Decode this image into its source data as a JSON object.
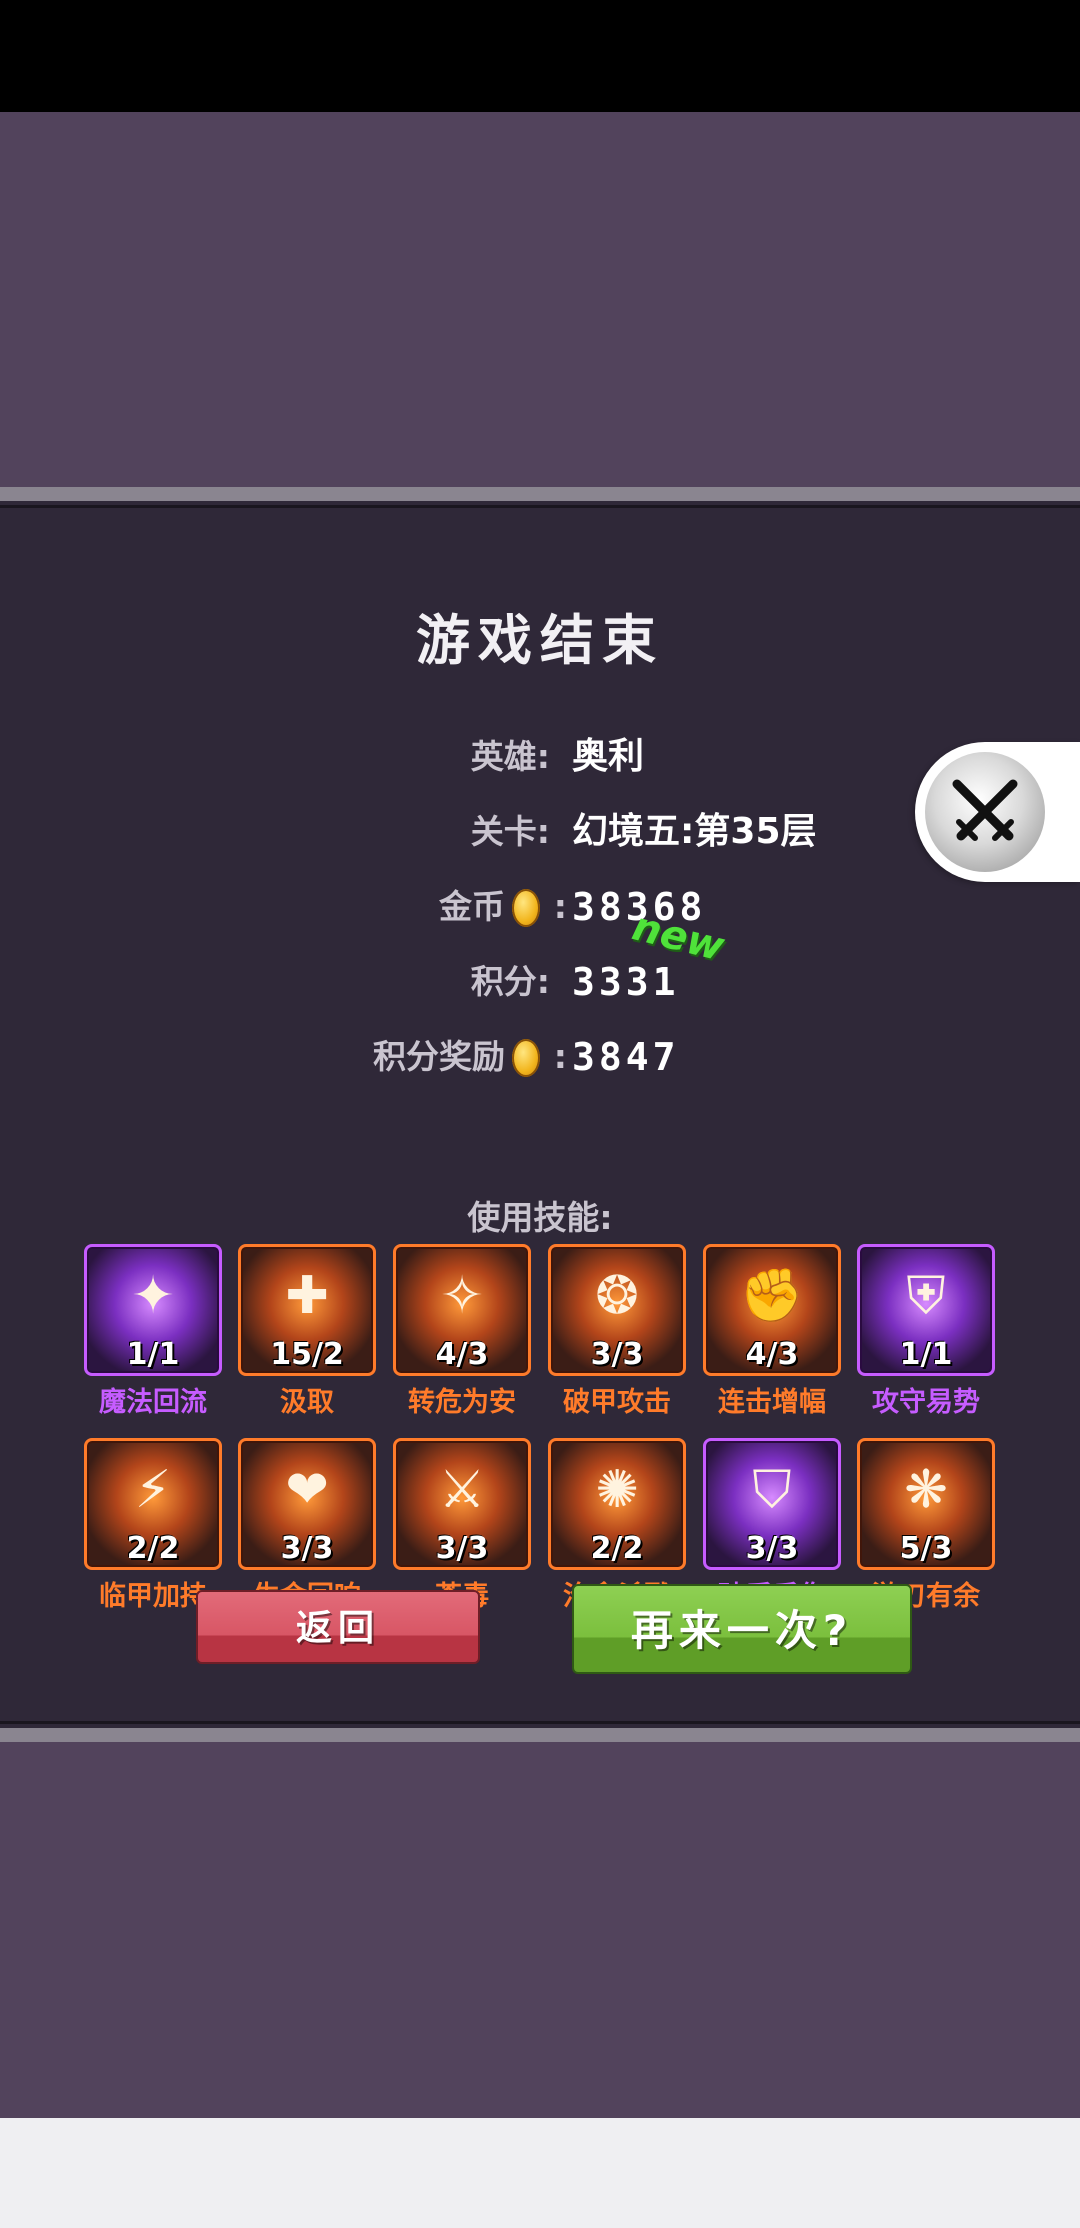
{
  "panel": {
    "title": "游戏结束",
    "stats": {
      "hero_label": "英雄:",
      "hero_value": "奥利",
      "stage_label": "关卡:",
      "stage_value": "幻境五:第35层",
      "gold_label": "金币",
      "gold_colon": ":",
      "gold_value": "38368",
      "score_label": "积分:",
      "score_value": "3331",
      "new_badge": "new",
      "reward_label": "积分奖励",
      "reward_colon": ":",
      "reward_value": "3847"
    },
    "skills_title": "使用技能:",
    "skills": [
      {
        "name": "魔法回流",
        "count": "1/1",
        "color": "purple",
        "icon": "magic-flow-icon"
      },
      {
        "name": "汲取",
        "count": "15/2",
        "color": "orange",
        "icon": "absorb-icon"
      },
      {
        "name": "转危为安",
        "count": "4/3",
        "color": "orange",
        "icon": "safety-icon"
      },
      {
        "name": "破甲攻击",
        "count": "3/3",
        "color": "orange",
        "icon": "armor-break-icon"
      },
      {
        "name": "连击增幅",
        "count": "4/3",
        "color": "orange",
        "icon": "combo-boost-icon"
      },
      {
        "name": "攻守易势",
        "count": "1/1",
        "color": "purple",
        "icon": "stance-swap-icon"
      },
      {
        "name": "临甲加持",
        "count": "2/2",
        "color": "orange",
        "icon": "armor-blessing-icon"
      },
      {
        "name": "生命回响",
        "count": "3/3",
        "color": "orange",
        "icon": "life-echo-icon"
      },
      {
        "name": "荼毒",
        "count": "3/3",
        "color": "orange",
        "icon": "poison-blade-icon"
      },
      {
        "name": "治愈杀戮",
        "count": "2/2",
        "color": "orange",
        "icon": "heal-slay-icon"
      },
      {
        "name": "破盾反伤",
        "count": "3/3",
        "color": "purple",
        "icon": "shield-reflect-icon"
      },
      {
        "name": "游刃有余",
        "count": "5/3",
        "color": "orange",
        "icon": "blade-ease-icon"
      }
    ],
    "buttons": {
      "back": "返回",
      "retry": "再来一次?"
    }
  },
  "colors": {
    "background": "#52435c",
    "panel": "#2f2838",
    "orange_skill": "#ff7b2a",
    "purple_skill": "#c65cff",
    "back_button": "#d85665",
    "retry_button": "#7bbf3d",
    "new_badge": "#4fe23a"
  }
}
